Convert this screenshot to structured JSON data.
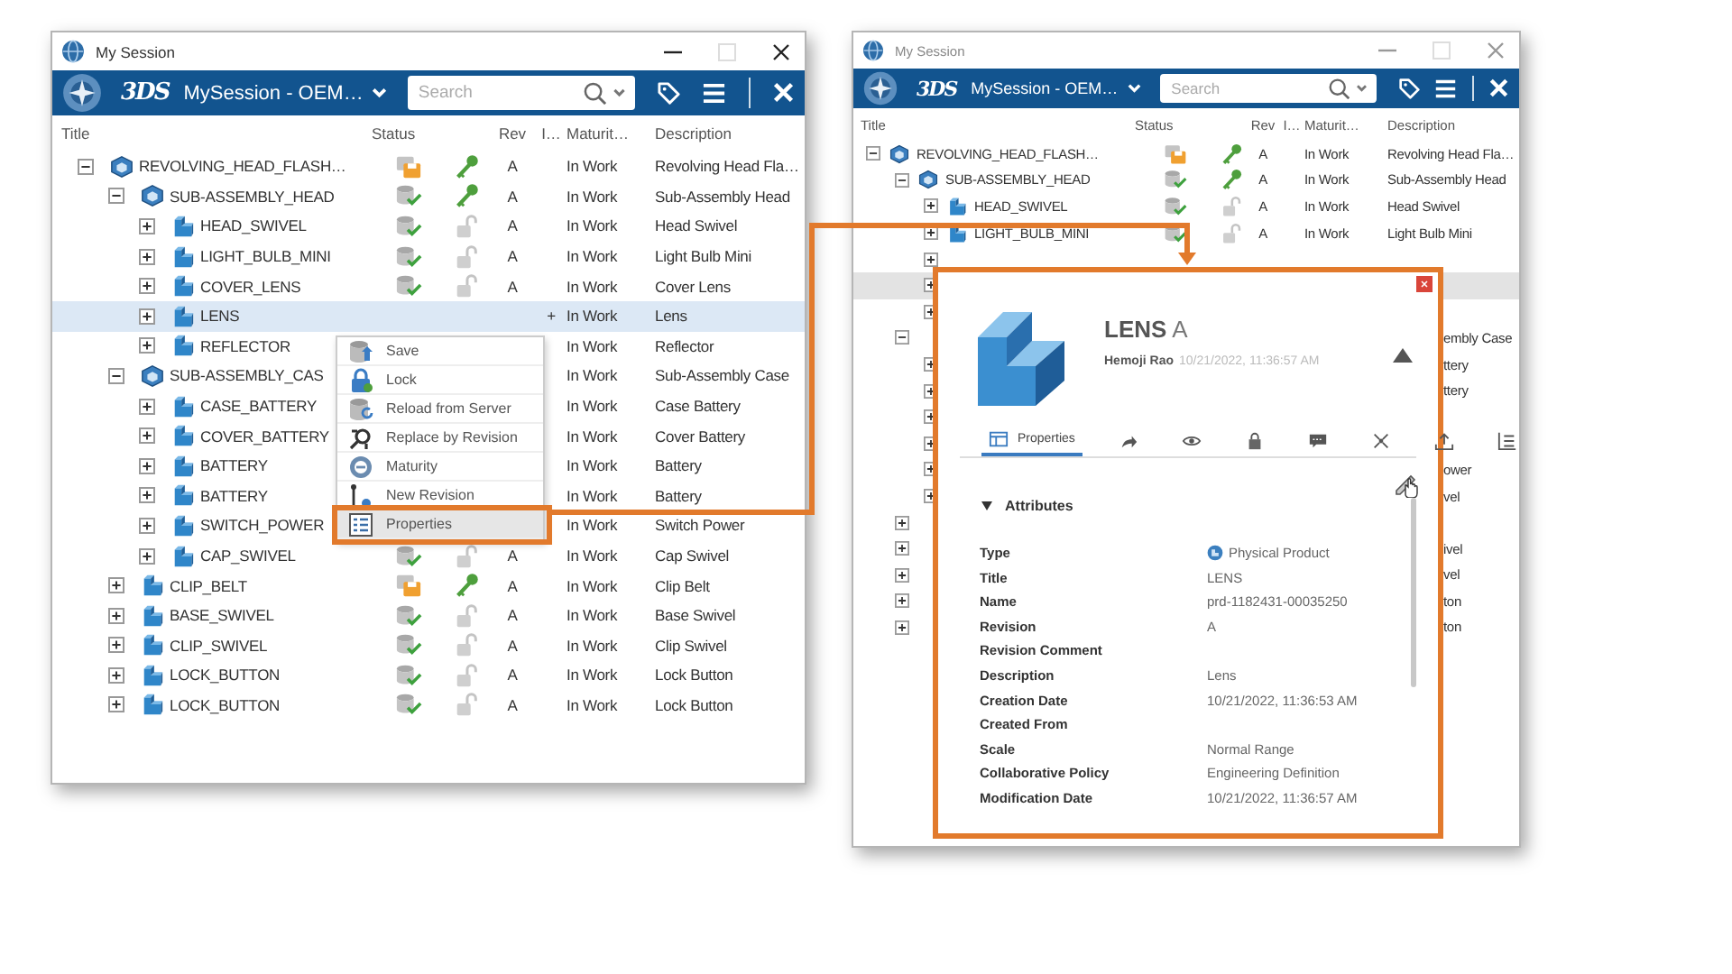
{
  "left_window": {
    "title": "My Session",
    "logo": "3DS",
    "session": "MySession - OEM…",
    "search": {
      "placeholder": "Search"
    },
    "columns": [
      "Title",
      "Status",
      "Rev",
      "I…",
      "Maturit…",
      "Description"
    ],
    "tree": [
      {
        "title": "REVOLVING_HEAD_FLASH…",
        "saved_locally": true,
        "reserved": true,
        "rev": "A",
        "maturity": "In Work",
        "description": "Revolving Head Fla…",
        "expanded": true,
        "selected": false,
        "children": [
          {
            "title": "SUB-ASSEMBLY_HEAD",
            "saved_locally": false,
            "reserved": true,
            "rev": "A",
            "maturity": "In Work",
            "description": "Sub-Assembly Head",
            "expanded": true,
            "selected": false,
            "children": [
              {
                "title": "HEAD_SWIVEL",
                "saved_locally": false,
                "reserved": false,
                "rev": "A",
                "maturity": "In Work",
                "description": "Head Swivel",
                "expanded": false,
                "selected": false
              },
              {
                "title": "LIGHT_BULB_MINI",
                "saved_locally": false,
                "reserved": false,
                "rev": "A",
                "maturity": "In Work",
                "description": "Light Bulb Mini",
                "expanded": false,
                "selected": false
              },
              {
                "title": "COVER_LENS",
                "saved_locally": false,
                "reserved": false,
                "rev": "A",
                "maturity": "In Work",
                "description": "Cover Lens",
                "expanded": false,
                "selected": false
              },
              {
                "title": "LENS",
                "flag": "+",
                "maturity": "In Work",
                "description": "Lens",
                "expanded": false,
                "selected": true
              },
              {
                "title": "REFLECTOR",
                "maturity": "In Work",
                "description": "Reflector",
                "expanded": false,
                "selected": false
              }
            ]
          },
          {
            "title": "SUB-ASSEMBLY_CAS",
            "maturity": "In Work",
            "description": "Sub-Assembly Case",
            "expanded": true,
            "selected": false,
            "children": [
              {
                "title": "CASE_BATTERY",
                "maturity": "In Work",
                "description": "Case Battery",
                "expanded": false,
                "selected": false
              },
              {
                "title": "COVER_BATTERY",
                "maturity": "In Work",
                "description": "Cover Battery",
                "expanded": false,
                "selected": false
              },
              {
                "title": "BATTERY",
                "maturity": "In Work",
                "description": "Battery",
                "expanded": false,
                "selected": false
              },
              {
                "title": "BATTERY",
                "maturity": "In Work",
                "description": "Battery",
                "expanded": false,
                "selected": false
              },
              {
                "title": "SWITCH_POWER",
                "maturity": "In Work",
                "description": "Switch Power",
                "expanded": false,
                "selected": false
              },
              {
                "title": "CAP_SWIVEL",
                "saved_locally": false,
                "reserved": false,
                "rev": "A",
                "maturity": "In Work",
                "description": "Cap Swivel",
                "expanded": false,
                "selected": false
              }
            ]
          },
          {
            "title": "CLIP_BELT",
            "saved_locally": true,
            "reserved": true,
            "rev": "A",
            "maturity": "In Work",
            "description": "Clip Belt",
            "expanded": false,
            "selected": false
          },
          {
            "title": "BASE_SWIVEL",
            "saved_locally": false,
            "reserved": false,
            "rev": "A",
            "maturity": "In Work",
            "description": "Base Swivel",
            "expanded": false,
            "selected": false
          },
          {
            "title": "CLIP_SWIVEL",
            "saved_locally": false,
            "reserved": false,
            "rev": "A",
            "maturity": "In Work",
            "description": "Clip Swivel",
            "expanded": false,
            "selected": false
          },
          {
            "title": "LOCK_BUTTON",
            "saved_locally": false,
            "reserved": false,
            "rev": "A",
            "maturity": "In Work",
            "description": "Lock Button",
            "expanded": false,
            "selected": false
          },
          {
            "title": "LOCK_BUTTON",
            "saved_locally": false,
            "reserved": false,
            "rev": "A",
            "maturity": "In Work",
            "description": "Lock Button",
            "expanded": false,
            "selected": false
          }
        ]
      }
    ]
  },
  "context_menu": [
    {
      "kind": "save",
      "label": "Save",
      "selected": false
    },
    {
      "kind": "lock",
      "label": "Lock",
      "selected": false
    },
    {
      "kind": "reload",
      "label": "Reload from Server",
      "selected": false
    },
    {
      "kind": "replace",
      "label": "Replace by Revision",
      "selected": false
    },
    {
      "kind": "maturity",
      "label": "Maturity",
      "selected": false
    },
    {
      "kind": "revision",
      "label": "New Revision",
      "selected": false
    },
    {
      "kind": "properties",
      "label": "Properties",
      "selected": true
    }
  ],
  "right_window": {
    "title": "My Session",
    "logo": "3DS",
    "session": "MySession - OEM…",
    "search": {
      "placeholder": "Search"
    },
    "columns": [
      "Title",
      "Status",
      "Rev",
      "I…",
      "Maturit…",
      "Description"
    ],
    "tree": [
      {
        "title": "REVOLVING_HEAD_FLASH…",
        "saved_locally": true,
        "reserved": true,
        "rev": "A",
        "maturity": "In Work",
        "description": "Revolving Head Fla…",
        "expanded": true,
        "selected": false,
        "children": [
          {
            "title": "SUB-ASSEMBLY_HEAD",
            "saved_locally": false,
            "reserved": true,
            "rev": "A",
            "maturity": "In Work",
            "description": "Sub-Assembly Head",
            "expanded": true,
            "selected": false,
            "children": [
              {
                "title": "HEAD_SWIVEL",
                "saved_locally": false,
                "reserved": false,
                "rev": "A",
                "maturity": "In Work",
                "description": "Head Swivel",
                "expanded": false,
                "selected": false
              },
              {
                "title": "LIGHT_BULB_MINI",
                "saved_locally": false,
                "reserved": false,
                "rev": "A",
                "maturity": "In Work",
                "description": "Light Bulb Mini",
                "expanded": false,
                "selected": false
              },
              {
                "expanded": false,
                "selected": false
              },
              {
                "expanded": false,
                "selected": true
              },
              {
                "expanded": false,
                "selected": false
              }
            ]
          },
          {
            "description_fragment": "embly Case",
            "expanded": true,
            "selected": false,
            "children": [
              {
                "description_fragment": "ttery",
                "expanded": false,
                "selected": false
              },
              {
                "description_fragment": "ttery",
                "expanded": false,
                "selected": false
              },
              {
                "expanded": false,
                "selected": false
              },
              {
                "expanded": false,
                "selected": false
              },
              {
                "description_fragment": "ower",
                "expanded": false,
                "selected": false
              },
              {
                "description_fragment": "vel",
                "expanded": false,
                "selected": false
              }
            ]
          },
          {
            "expanded": false,
            "selected": false
          },
          {
            "description_fragment": "ivel",
            "expanded": false,
            "selected": false
          },
          {
            "description_fragment": "vel",
            "expanded": false,
            "selected": false
          },
          {
            "description_fragment": "ton",
            "expanded": false,
            "selected": false
          },
          {
            "description_fragment": "ton",
            "expanded": false,
            "selected": false
          }
        ]
      }
    ]
  },
  "properties_panel": {
    "title": "**LENS** A",
    "author": "Hemoji Rao",
    "date": "10/21/2022, 11:36:57 AM",
    "tabs": [
      {
        "kind": "properties",
        "label": "Properties",
        "selected": true
      },
      {
        "kind": "share",
        "selected": false
      },
      {
        "kind": "view",
        "selected": false
      },
      {
        "kind": "lock",
        "selected": false
      },
      {
        "kind": "comment",
        "selected": false
      },
      {
        "kind": "relations",
        "selected": false
      },
      {
        "kind": "upload",
        "selected": false
      },
      {
        "kind": "checklist",
        "selected": false
      }
    ],
    "section": {
      "title": "Attributes",
      "expanded": true
    },
    "attributes": [
      {
        "label": "Type",
        "value": "Physical Product",
        "kind": "type"
      },
      {
        "label": "Title",
        "value": "LENS"
      },
      {
        "label": "Name",
        "value": "prd-1182431-00035250"
      },
      {
        "label": "Revision",
        "value": "A"
      },
      {
        "label": "Revision Comment"
      },
      {
        "label": "Description",
        "value": "Lens"
      },
      {
        "label": "Creation Date",
        "value": "10/21/2022, 11:36:53 AM"
      },
      {
        "label": "Created From"
      },
      {
        "label": "Scale",
        "value": "Normal Range"
      },
      {
        "label": "Collaborative Policy",
        "value": "Engineering Definition"
      },
      {
        "label": "Modification Date",
        "value": "10/21/2022, 11:36:57 AM"
      }
    ]
  }
}
